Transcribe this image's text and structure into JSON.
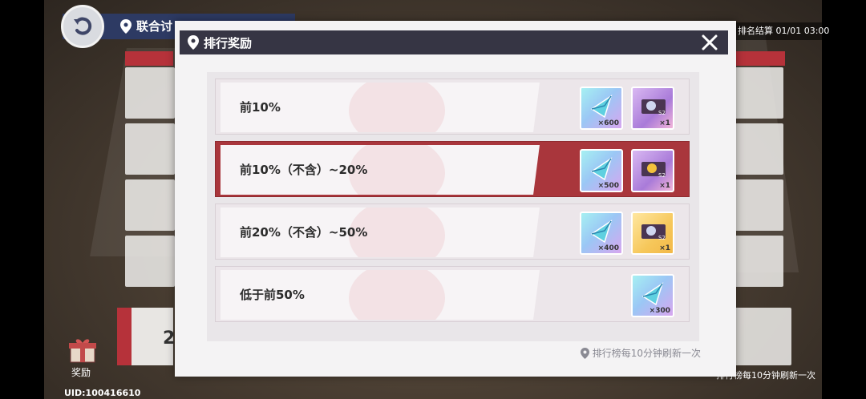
{
  "background": {
    "location_title": "联合讨",
    "rank_settle_text": "排名结算 01/01 03:00",
    "gift_label": "奖励",
    "uid_text": "UID:100416610",
    "refresh_text": "排行榜每10分钟刷新一次",
    "card_number": "2"
  },
  "modal": {
    "title": "排行奖励",
    "rows": [
      {
        "label": "前10%",
        "items": [
          {
            "icon": "blue-crystal-icon",
            "qty": "×600"
          },
          {
            "icon": "s2-ticket-icon",
            "qty": "×1"
          }
        ]
      },
      {
        "label": "前10%（不含）~20%",
        "items": [
          {
            "icon": "blue-crystal-icon",
            "qty": "×500"
          },
          {
            "icon": "gold-ticket-icon",
            "qty": "×1"
          }
        ]
      },
      {
        "label": "前20%（不含）~50%",
        "items": [
          {
            "icon": "blue-crystal-icon",
            "qty": "×400"
          },
          {
            "icon": "s2-ticket-icon",
            "qty": "×1"
          }
        ]
      },
      {
        "label": "低于前50%",
        "items": [
          {
            "icon": "blue-crystal-icon",
            "qty": "×300"
          }
        ]
      }
    ],
    "footnote": "排行榜每10分钟刷新一次"
  },
  "colors": {
    "header": "#363544",
    "active_row": "#a9363c"
  }
}
